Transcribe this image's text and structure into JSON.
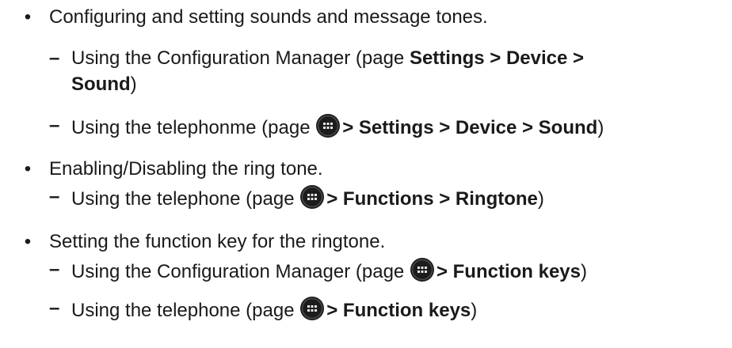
{
  "bullet_symbol": "•",
  "dash_symbol": "–",
  "icon_name": "app-menu-icon",
  "items": [
    {
      "text": "Configuring and setting sounds and message tones.",
      "subitems": [
        {
          "prefix": "Using the Configuration Manager (page ",
          "bold_line1": "Settings > Device >",
          "bold_line2": "Sound",
          "suffix": ")"
        },
        {
          "prefix": "Using the telephonme (page ",
          "bold": "> Settings > Device > Sound",
          "suffix": ")"
        }
      ]
    },
    {
      "text": "Enabling/Disabling the ring tone.",
      "subitems": [
        {
          "prefix": "Using the telephone (page ",
          "bold": "> Functions > Ringtone",
          "suffix": ")"
        }
      ]
    },
    {
      "text": "Setting the function key for the ringtone.",
      "subitems": [
        {
          "prefix": "Using the Configuration Manager (page ",
          "bold": "> Function keys",
          "suffix": ")"
        },
        {
          "prefix": "Using the telephone (page ",
          "bold": "> Function keys",
          "suffix": ")"
        }
      ]
    }
  ]
}
